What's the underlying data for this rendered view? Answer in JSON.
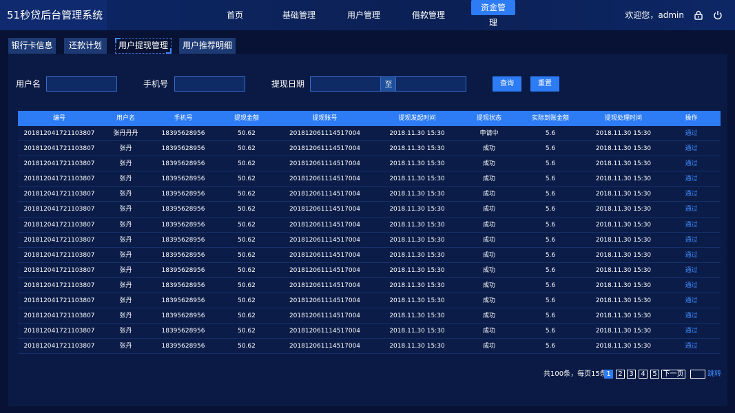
{
  "app": {
    "title": "51秒贷后台管理系统"
  },
  "nav": {
    "items": [
      {
        "label": "首页"
      },
      {
        "label": "基础管理"
      },
      {
        "label": "用户管理"
      },
      {
        "label": "借款管理"
      },
      {
        "label": "资金管理",
        "active": true
      }
    ]
  },
  "user": {
    "greeting": "欢迎您，admin",
    "lock_icon": "lock-icon",
    "power_icon": "power-icon"
  },
  "tabs": [
    {
      "label": "银行卡信息"
    },
    {
      "label": "还款计划"
    },
    {
      "label": "用户提现管理",
      "active": true
    },
    {
      "label": "用户推荐明细"
    }
  ],
  "filters": {
    "username_label": "用户名",
    "username_value": "",
    "phone_label": "手机号",
    "phone_value": "",
    "date_label": "提现日期",
    "date_from": "",
    "date_sep": "至",
    "date_to": "",
    "query_button": "查询",
    "reset_button": "重置"
  },
  "table": {
    "headers": [
      "编号",
      "用户名",
      "手机号",
      "提现金额",
      "提现账号",
      "提现发起时间",
      "提现状态",
      "实际到账金额",
      "提现处理时间",
      "操作"
    ],
    "rows": [
      [
        "201812041721103807",
        "张丹丹丹",
        "18395628956",
        "50.62",
        "201812061114517004",
        "2018.11.30 15:30",
        "申请中",
        "5.6",
        "2018.11.30 15:30",
        "通过"
      ],
      [
        "201812041721103807",
        "张丹",
        "18395628956",
        "50.62",
        "201812061114517004",
        "2018.11.30 15:30",
        "成功",
        "5.6",
        "2018.11.30 15:30",
        "通过"
      ],
      [
        "201812041721103807",
        "张丹",
        "18395628956",
        "50.62",
        "201812061114517004",
        "2018.11.30 15:30",
        "成功",
        "5.6",
        "2018.11.30 15:30",
        "通过"
      ],
      [
        "201812041721103807",
        "张丹",
        "18395628956",
        "50.62",
        "201812061114517004",
        "2018.11.30 15:30",
        "成功",
        "5.6",
        "2018.11.30 15:30",
        "通过"
      ],
      [
        "201812041721103807",
        "张丹",
        "18395628956",
        "50.62",
        "201812061114517004",
        "2018.11.30 15:30",
        "成功",
        "5.6",
        "2018.11.30 15:30",
        "通过"
      ],
      [
        "201812041721103807",
        "张丹",
        "18395628956",
        "50.62",
        "201812061114517004",
        "2018.11.30 15:30",
        "成功",
        "5.6",
        "2018.11.30 15:30",
        "通过"
      ],
      [
        "201812041721103807",
        "张丹",
        "18395628956",
        "50.62",
        "201812061114517004",
        "2018.11.30 15:30",
        "成功",
        "5.6",
        "2018.11.30 15:30",
        "通过"
      ],
      [
        "201812041721103807",
        "张丹",
        "18395628956",
        "50.62",
        "201812061114517004",
        "2018.11.30 15:30",
        "成功",
        "5.6",
        "2018.11.30 15:30",
        "通过"
      ],
      [
        "201812041721103807",
        "张丹",
        "18395628956",
        "50.62",
        "201812061114517004",
        "2018.11.30 15:30",
        "成功",
        "5.6",
        "2018.11.30 15:30",
        "通过"
      ],
      [
        "201812041721103807",
        "张丹",
        "18395628956",
        "50.62",
        "201812061114517004",
        "2018.11.30 15:30",
        "成功",
        "5.6",
        "2018.11.30 15:30",
        "通过"
      ],
      [
        "201812041721103807",
        "张丹",
        "18395628956",
        "50.62",
        "201812061114517004",
        "2018.11.30 15:30",
        "成功",
        "5.6",
        "2018.11.30 15:30",
        "通过"
      ],
      [
        "201812041721103807",
        "张丹",
        "18395628956",
        "50.62",
        "201812061114517004",
        "2018.11.30 15:30",
        "成功",
        "5.6",
        "2018.11.30 15:30",
        "通过"
      ],
      [
        "201812041721103807",
        "张丹",
        "18395628956",
        "50.62",
        "201812061114517004",
        "2018.11.30 15:30",
        "成功",
        "5.6",
        "2018.11.30 15:30",
        "通过"
      ],
      [
        "201812041721103807",
        "张丹",
        "18395628956",
        "50.62",
        "201812061114517004",
        "2018.11.30 15:30",
        "成功",
        "5.6",
        "2018.11.30 15:30",
        "通过"
      ],
      [
        "201812041721103807",
        "张丹",
        "18395628956",
        "50.62",
        "201812061114517004",
        "2018.11.30 15:30",
        "成功",
        "5.6",
        "2018.11.30 15:30",
        "通过"
      ]
    ]
  },
  "pagination": {
    "summary": "共100条，每页15条",
    "pages": [
      "1",
      "2",
      "3",
      "4",
      "5"
    ],
    "current": "1",
    "next": "下一页",
    "jump_value": "",
    "jump_label": "跳转"
  },
  "colors": {
    "accent": "#2d7cf6",
    "background": "#071234",
    "link": "#3d8bff"
  }
}
